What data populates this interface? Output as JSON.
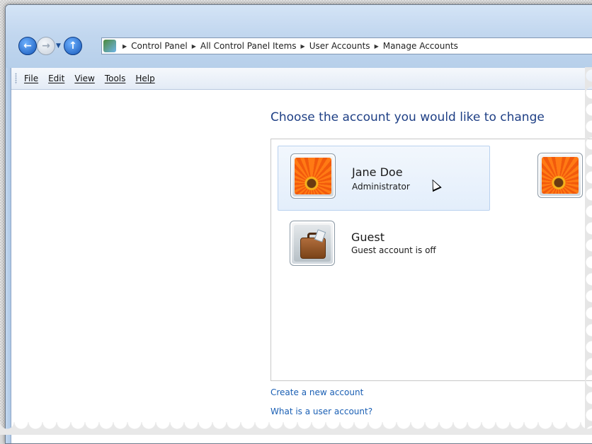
{
  "address_bar": {
    "breadcrumbs": [
      "Control Panel",
      "All Control Panel Items",
      "User Accounts",
      "Manage Accounts"
    ]
  },
  "menu": {
    "items": [
      "File",
      "Edit",
      "View",
      "Tools",
      "Help"
    ]
  },
  "main": {
    "heading": "Choose the account you would like to change",
    "accounts": [
      {
        "name": "Jane Doe",
        "type": "Administrator",
        "picture": "orange-flower-icon"
      },
      {
        "name": "Guest",
        "type": "Guest account is off",
        "picture": "suitcase-icon"
      }
    ],
    "links": [
      "Create a new account",
      "What is a user account?"
    ]
  }
}
